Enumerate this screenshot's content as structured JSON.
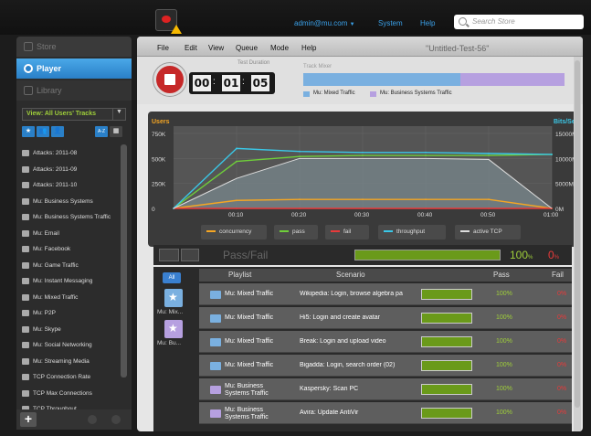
{
  "header": {
    "user": "admin@mu.com",
    "user_caret": "▼",
    "system": "System",
    "help": "Help",
    "search_placeholder": "Search Store"
  },
  "sidebar": {
    "nav": [
      {
        "label": "Store"
      },
      {
        "label": "Player"
      },
      {
        "label": "Library"
      }
    ],
    "view_select": "View: All Users' Tracks",
    "view_caret": "▼",
    "toolbar": [
      "★",
      "👥",
      "👤",
      "A-Z",
      "▦"
    ],
    "tracks": [
      "Attacks: 2011-08",
      "Attacks: 2011-09",
      "Attacks: 2011-10",
      "Mu: Business Systems",
      "Mu: Business Systems Traffic",
      "Mu: Email",
      "Mu: Facebook",
      "Mu: Game Traffic",
      "Mu: Instant Messaging",
      "Mu: Mixed Traffic",
      "Mu: P2P",
      "Mu: Skype",
      "Mu: Social Networking",
      "Mu: Streaming Media",
      "TCP Connection Rate",
      "TCP Max Connections",
      "TCP Throughout"
    ],
    "add_label": "+"
  },
  "menubar": {
    "items": [
      "File",
      "Edit",
      "View",
      "Queue",
      "Mode",
      "Help"
    ],
    "doc_title": "\"Untitled-Test-56\""
  },
  "transport": {
    "duration_label": "Test Duration",
    "hours": "00",
    "minutes": "01",
    "seconds": "05",
    "sep": ":",
    "mixer_label": "Track Mixer",
    "mixer": [
      {
        "name": "Mu: Mixed Traffic",
        "color": "#7ab0e0",
        "share": 0.6
      },
      {
        "name": "Mu: Business Systems Traffic",
        "color": "#b6a0e0",
        "share": 0.4
      }
    ]
  },
  "chart_data": {
    "type": "line",
    "left_axis_title": "Users",
    "right_axis_title": "Bits/Se",
    "y_ticks_left": [
      "750K",
      "500K",
      "250K",
      "0"
    ],
    "y_ticks_right": [
      "15000M",
      "10000M",
      "5000M",
      "0M"
    ],
    "x": [
      "00:00",
      "00:10",
      "00:20",
      "00:30",
      "00:40",
      "00:50",
      "01:00"
    ],
    "x_ticks": [
      "00:10",
      "00:20",
      "00:30",
      "00:40",
      "00:50",
      "01:00"
    ],
    "ylim_left": [
      0,
      750000
    ],
    "series": [
      {
        "name": "concurrency",
        "color": "#f5a623",
        "values": [
          0,
          80000,
          90000,
          90000,
          90000,
          90000,
          0
        ]
      },
      {
        "name": "pass",
        "color": "#6fcf3a",
        "values": [
          0,
          470000,
          520000,
          530000,
          530000,
          530000,
          540000
        ]
      },
      {
        "name": "fail",
        "color": "#e83a3a",
        "values": [
          0,
          0,
          0,
          0,
          0,
          0,
          0
        ]
      },
      {
        "name": "throughput",
        "color": "#3ac8e8",
        "values": [
          0,
          600000,
          570000,
          560000,
          560000,
          550000,
          540000
        ]
      },
      {
        "name": "active TCP",
        "color": "#dddddd",
        "values": [
          0,
          300000,
          500000,
          500000,
          500000,
          490000,
          0
        ]
      }
    ]
  },
  "passfail": {
    "title": "Pass/Fail",
    "pass_value": "100",
    "pass_unit": "%",
    "fail_value": "0",
    "fail_unit": "%",
    "pass_fraction": 1.0
  },
  "table": {
    "all_label": "All",
    "suites": [
      {
        "label": "Mu: Mix...",
        "color": "#7ab0e0"
      },
      {
        "label": "Mu: Bu...",
        "color": "#b6a0e0"
      }
    ],
    "headers": {
      "playlist": "Playlist",
      "scenario": "Scenario",
      "pass": "Pass",
      "fail": "Fail"
    },
    "rows": [
      {
        "playlist": "Mu: Mixed Traffic",
        "scenario": "Wikipedia: Login, browse algebra pa",
        "pass": "100%",
        "fail": "0%",
        "color": "#7ab0e0"
      },
      {
        "playlist": "Mu: Mixed Traffic",
        "scenario": "Hi5: Login and create avatar",
        "pass": "100%",
        "fail": "0%",
        "color": "#7ab0e0"
      },
      {
        "playlist": "Mu: Mixed Traffic",
        "scenario": "Break: Login and upload video",
        "pass": "100%",
        "fail": "0%",
        "color": "#7ab0e0"
      },
      {
        "playlist": "Mu: Mixed Traffic",
        "scenario": "Bigadda: Login, search order (02)",
        "pass": "100%",
        "fail": "0%",
        "color": "#7ab0e0"
      },
      {
        "playlist": "Mu: Business Systems Traffic",
        "scenario": "Kaspersky: Scan PC",
        "pass": "100%",
        "fail": "0%",
        "color": "#b6a0e0"
      },
      {
        "playlist": "Mu: Business Systems Traffic",
        "scenario": "Avira: Update AntiVir",
        "pass": "100%",
        "fail": "0%",
        "color": "#b6a0e0"
      }
    ]
  }
}
